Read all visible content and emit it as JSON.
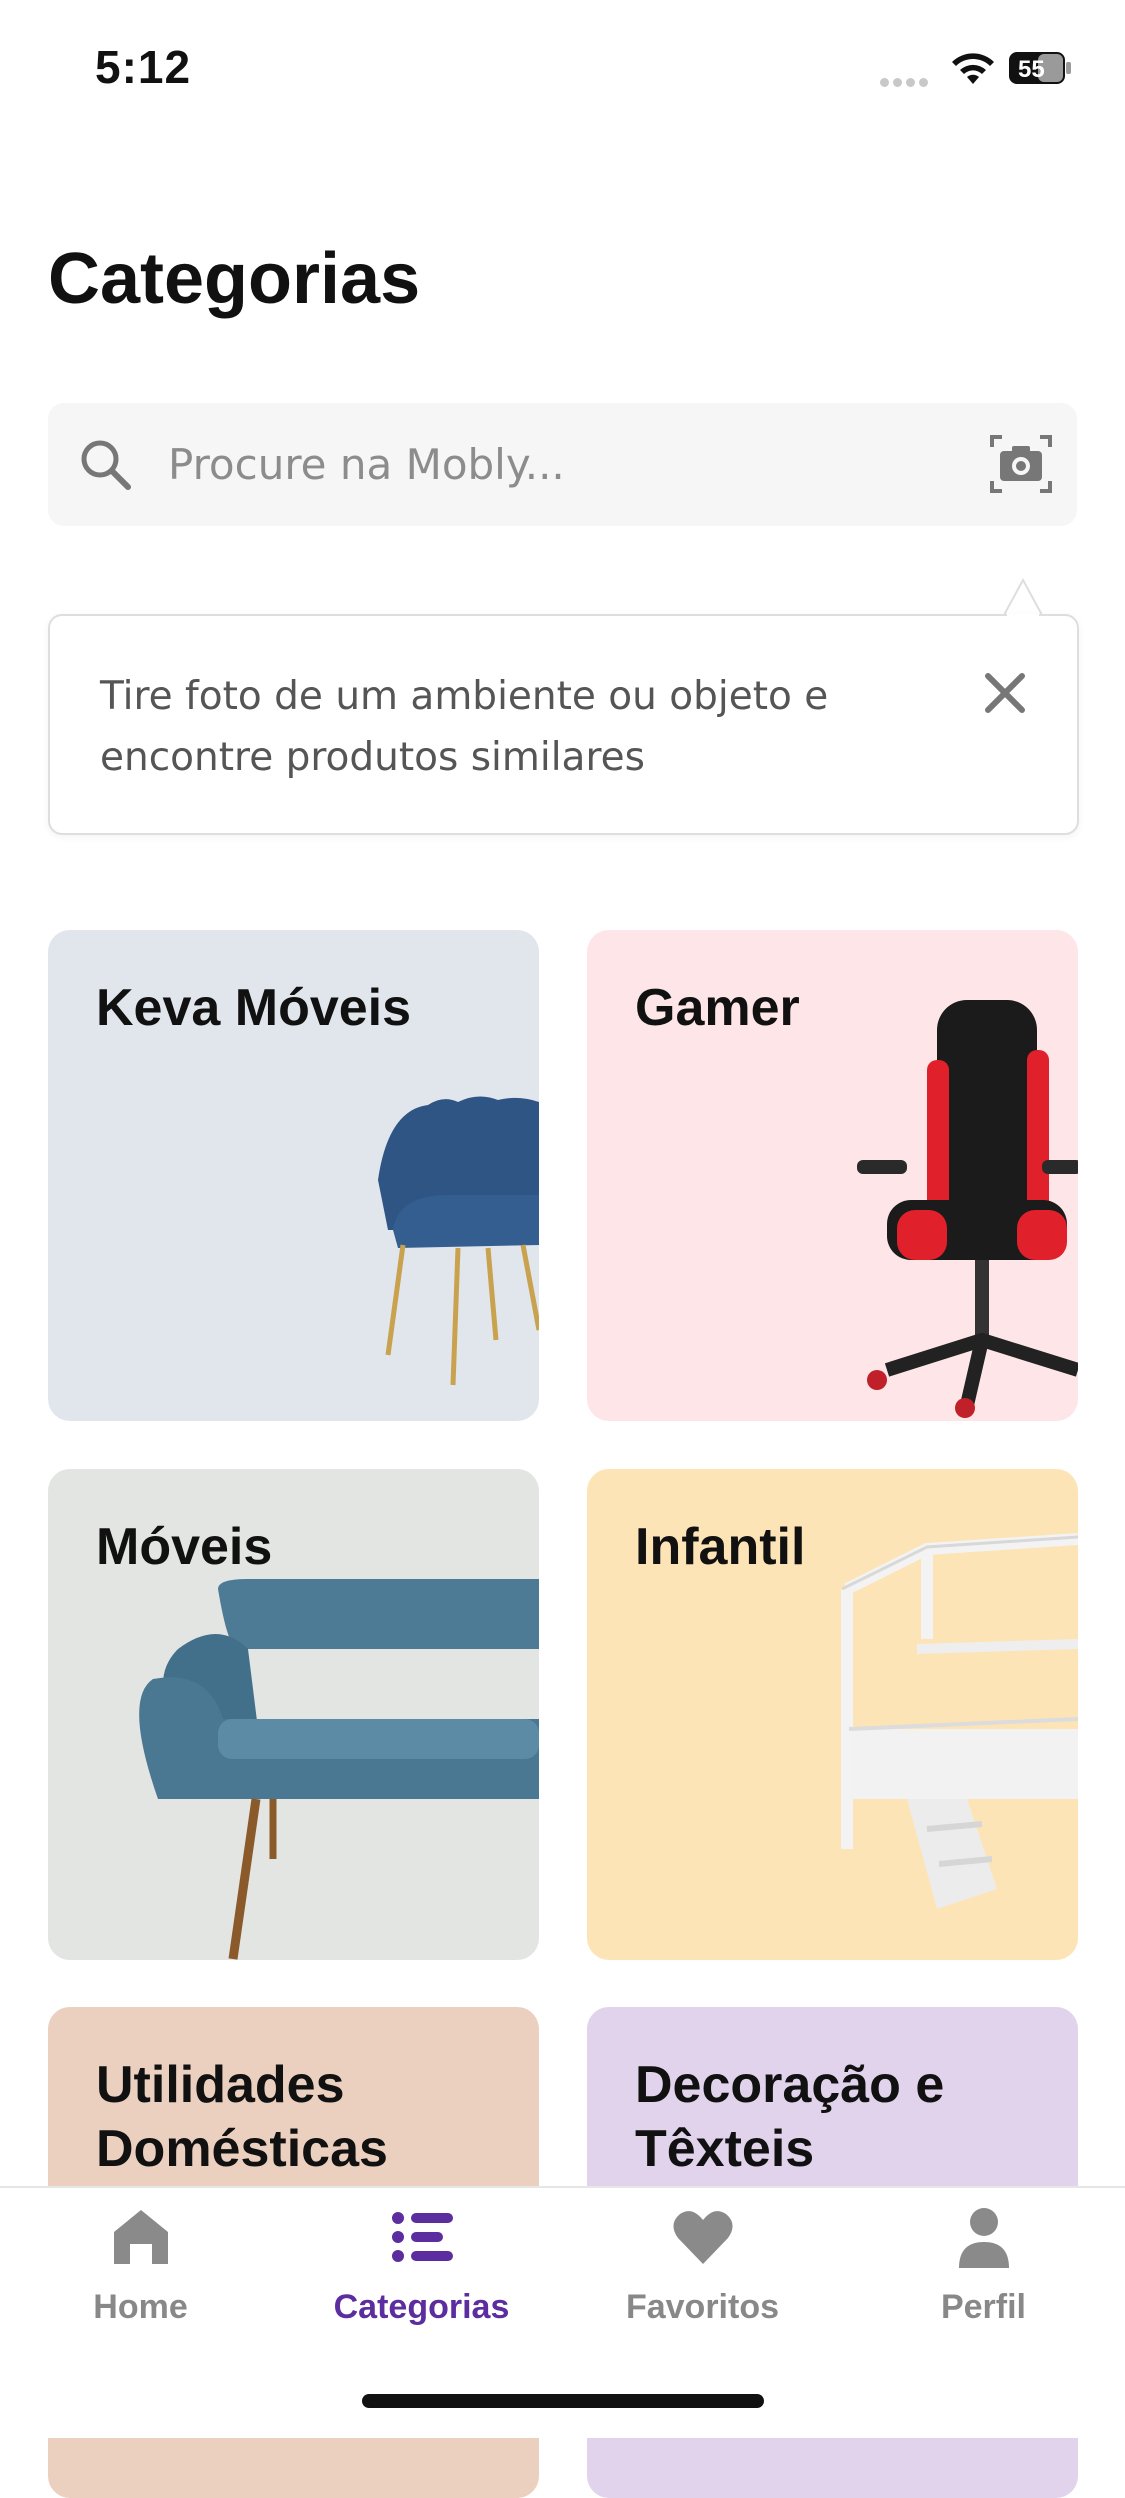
{
  "status_bar": {
    "time": "5:12",
    "battery_level": "55"
  },
  "header": {
    "title": "Categorias"
  },
  "search": {
    "placeholder": "Procure na Mobly...",
    "search_icon": "search-icon",
    "camera_icon": "camera-icon"
  },
  "tooltip": {
    "text": "Tire foto de um ambiente ou objeto e encontre produtos similares",
    "close_icon": "close-icon"
  },
  "categories": [
    {
      "label": "Keva Móveis",
      "bg": "#e0e6ec"
    },
    {
      "label": "Gamer",
      "bg": "#fde5e8"
    },
    {
      "label": "Móveis",
      "bg": "#e2e5e2"
    },
    {
      "label": "Infantil",
      "bg": "#fde4b6"
    },
    {
      "label": "Utilidades Domésticas",
      "bg": "#ebcfbf"
    },
    {
      "label": "Decoração e Têxteis",
      "bg": "#e2d3ec"
    }
  ],
  "tab_bar": {
    "items": [
      {
        "label": "Home",
        "icon": "home-icon"
      },
      {
        "label": "Categorias",
        "icon": "list-icon"
      },
      {
        "label": "Favoritos",
        "icon": "heart-icon"
      },
      {
        "label": "Perfil",
        "icon": "person-icon"
      }
    ],
    "active": "Categorias",
    "active_color": "#5b2d9e",
    "inactive_color": "#888888"
  }
}
